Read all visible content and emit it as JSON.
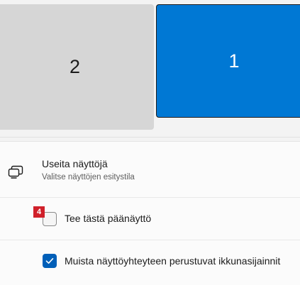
{
  "monitors": [
    {
      "number": "2",
      "selected": false
    },
    {
      "number": "1",
      "selected": true
    }
  ],
  "multiple_displays": {
    "icon": "multiple-displays-icon",
    "title": "Useita näyttöjä",
    "subtitle": "Valitse näyttöjen esitystila"
  },
  "make_primary": {
    "label": "Tee tästä päänäyttö",
    "checked": false,
    "badge": "4"
  },
  "remember_windows": {
    "label": "Muista näyttöyhteyteen perustuvat ikkunasijainnit",
    "checked": true
  },
  "colors": {
    "accent": "#0078d4",
    "checkbox_checked": "#005fb8",
    "badge": "#d0202a",
    "monitor_inactive": "#d6d6d6"
  }
}
